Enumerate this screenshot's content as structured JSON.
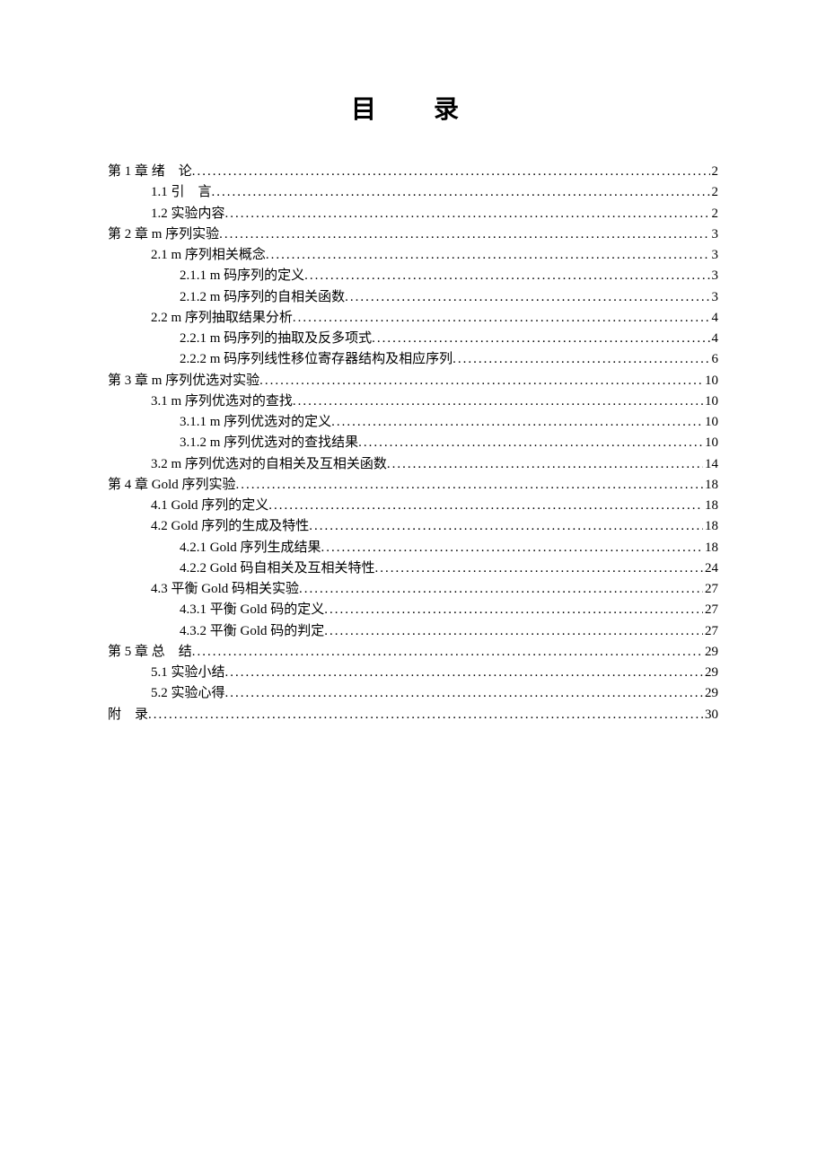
{
  "title": "目　录",
  "toc": [
    {
      "level": 0,
      "label": "第 1 章 绪　论",
      "page": "2"
    },
    {
      "level": 1,
      "label": "1.1 引　言",
      "page": "2"
    },
    {
      "level": 1,
      "label": "1.2 实验内容",
      "page": "2"
    },
    {
      "level": 0,
      "label": "第 2 章 m 序列实验",
      "page": "3"
    },
    {
      "level": 1,
      "label": "2.1 m 序列相关概念",
      "page": "3"
    },
    {
      "level": 2,
      "label": "2.1.1 m 码序列的定义",
      "page": "3"
    },
    {
      "level": 2,
      "label": "2.1.2 m 码序列的自相关函数",
      "page": "3"
    },
    {
      "level": 1,
      "label": "2.2 m 序列抽取结果分析",
      "page": "4"
    },
    {
      "level": 2,
      "label": "2.2.1 m 码序列的抽取及反多项式",
      "page": "4"
    },
    {
      "level": 2,
      "label": "2.2.2 m 码序列线性移位寄存器结构及相应序列",
      "page": "6"
    },
    {
      "level": 0,
      "label": "第 3 章 m 序列优选对实验",
      "page": "10"
    },
    {
      "level": 1,
      "label": "3.1 m 序列优选对的查找",
      "page": "10"
    },
    {
      "level": 2,
      "label": "3.1.1 m 序列优选对的定义",
      "page": "10"
    },
    {
      "level": 2,
      "label": "3.1.2 m 序列优选对的查找结果",
      "page": "10"
    },
    {
      "level": 1,
      "label": "3.2 m 序列优选对的自相关及互相关函数",
      "page": "14"
    },
    {
      "level": 0,
      "label": "第 4 章 Gold 序列实验",
      "page": "18"
    },
    {
      "level": 1,
      "label": "4.1 Gold 序列的定义",
      "page": "18"
    },
    {
      "level": 1,
      "label": "4.2 Gold 序列的生成及特性",
      "page": "18"
    },
    {
      "level": 2,
      "label": "4.2.1 Gold 序列生成结果",
      "page": "18"
    },
    {
      "level": 2,
      "label": "4.2.2 Gold 码自相关及互相关特性",
      "page": "24"
    },
    {
      "level": 1,
      "label": "4.3 平衡 Gold 码相关实验",
      "page": "27"
    },
    {
      "level": 2,
      "label": "4.3.1 平衡 Gold 码的定义",
      "page": "27"
    },
    {
      "level": 2,
      "label": "4.3.2 平衡 Gold 码的判定",
      "page": "27"
    },
    {
      "level": 0,
      "label": "第 5 章 总　结",
      "page": "29"
    },
    {
      "level": 1,
      "label": "5.1 实验小结",
      "page": "29"
    },
    {
      "level": 1,
      "label": "5.2 实验心得",
      "page": "29"
    },
    {
      "level": 0,
      "label": "附　录",
      "page": "30"
    }
  ]
}
